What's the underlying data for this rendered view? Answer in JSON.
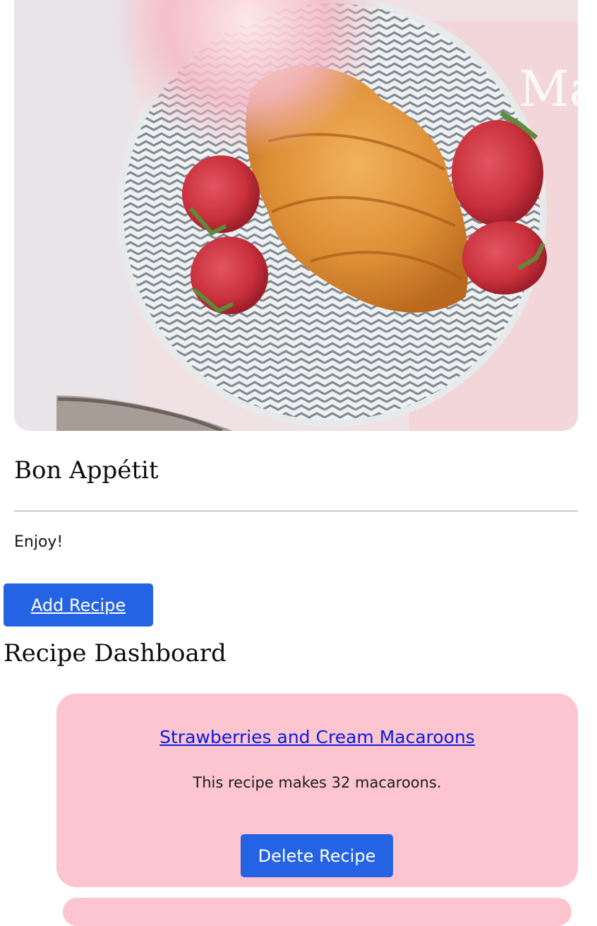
{
  "hero": {
    "image": "croissant-with-strawberries-on-patterned-plate-photo"
  },
  "header": {
    "title": "Bon Appétit",
    "subtitle": "Enjoy!"
  },
  "actions": {
    "add_recipe_label": "Add Recipe"
  },
  "dashboard": {
    "title": "Recipe Dashboard",
    "recipes": [
      {
        "title": "Strawberries and Cream Macaroons",
        "description": "This recipe makes 32 macaroons.",
        "delete_label": "Delete Recipe"
      }
    ]
  },
  "colors": {
    "button": "#2463e3",
    "card": "#fdc5d0",
    "link": "#0a1adf"
  }
}
